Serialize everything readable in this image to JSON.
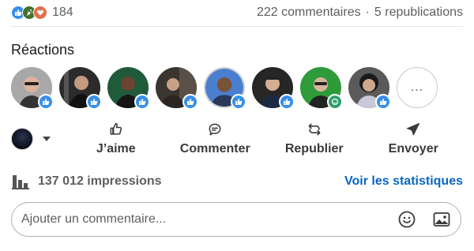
{
  "summary": {
    "reaction_count": "184",
    "comments": "222 commentaires",
    "separator": "·",
    "reposts": "5 republications",
    "reaction_types": [
      "like-icon",
      "celebrate-icon",
      "love-icon"
    ]
  },
  "reactions": {
    "title": "Réactions",
    "people": [
      {
        "reaction": "like-icon",
        "bg": "#8a8a8a"
      },
      {
        "reaction": "like-icon",
        "bg": "#2b2b2b"
      },
      {
        "reaction": "like-icon",
        "bg": "#1f5a3a"
      },
      {
        "reaction": "like-icon",
        "bg": "#3b3530"
      },
      {
        "reaction": "like-icon",
        "bg": "#4a7fd0"
      },
      {
        "reaction": "like-icon",
        "bg": "#2a2a2a"
      },
      {
        "reaction": "insightful-icon",
        "bg": "#2e9a3a"
      },
      {
        "reaction": "like-icon",
        "bg": "#3a3a3a"
      }
    ],
    "more_label": "..."
  },
  "actions": {
    "like": "J’aime",
    "comment": "Commenter",
    "repost": "Republier",
    "send": "Envoyer"
  },
  "impressions": {
    "text": "137 012 impressions",
    "stats_link": "Voir les statistiques"
  },
  "comment_box": {
    "placeholder": "Ajouter un commentaire..."
  },
  "colors": {
    "like": "#378fe9",
    "celebrate": "#44712e",
    "love": "#df704d",
    "insightful": "#2f9e6b",
    "link": "#0a66c2"
  }
}
